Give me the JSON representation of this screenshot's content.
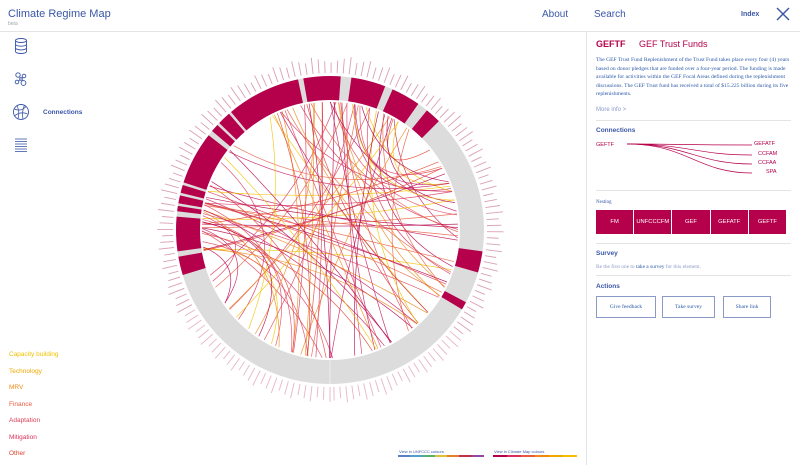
{
  "header": {
    "title": "Climate Regime Map",
    "subtitle": "beta",
    "nav_about": "About",
    "nav_search": "Search",
    "nav_index": "Index"
  },
  "sidebar": {
    "items": [
      {
        "name": "database-icon",
        "label": ""
      },
      {
        "name": "network-icon",
        "label": ""
      },
      {
        "name": "connections-icon",
        "label": "Connections"
      },
      {
        "name": "list-icon",
        "label": ""
      }
    ]
  },
  "legend": {
    "items": [
      {
        "label": "Capacity building",
        "color": "#f2c200"
      },
      {
        "label": "Technology",
        "color": "#f0a800"
      },
      {
        "label": "MRV",
        "color": "#ef8a17"
      },
      {
        "label": "Finance",
        "color": "#e85a3f"
      },
      {
        "label": "Adaptation",
        "color": "#e0405a"
      },
      {
        "label": "Mitigation",
        "color": "#d8315b"
      },
      {
        "label": "Other",
        "color": "#e2402b"
      }
    ]
  },
  "footer": {
    "unfccc_link": "View in UNFCCC colours",
    "crm_link": "View in Climate Map colours",
    "unfccc_colors": [
      "#5b7ec4",
      "#4ea2c9",
      "#58b06a",
      "#e0c03a",
      "#e2802a",
      "#c4304a",
      "#8e4aa8"
    ],
    "crm_colors": [
      "#b5004b",
      "#d8315b",
      "#e85a3f",
      "#ef8a17",
      "#f0a800",
      "#f2c200"
    ]
  },
  "panel": {
    "code": "GEFTF",
    "name": "GEF Trust Funds",
    "description": "The GEF Trust Fund Replenishment of the Trust Fund takes place every four (4) years based on donor pledges that are funded over a four-year period. The funding is made available for activities within the GEF Focal Areas defined during the replenishment discussions. The GEF Trust fund has received a total of $15.225 billion during its five replenishments.",
    "more_info": "More info >",
    "connections_title": "Connections",
    "connection_source": "GEFTF",
    "connection_targets": [
      "GEFATF",
      "CCFAM",
      "CCFAA",
      "SPA"
    ],
    "nesting_title": "Nesting",
    "nesting": [
      "FM",
      "UNFCCCFM",
      "GEF",
      "GEFATF",
      "GEFTF"
    ],
    "survey_title": "Survey",
    "survey_prefix": "Be the first one to",
    "survey_link": "take a survey",
    "survey_suffix": "for this element.",
    "actions_title": "Actions",
    "actions": [
      "Give feedback",
      "Take survey",
      "Share link"
    ]
  },
  "colors": {
    "accent": "#b5004b",
    "link": "#3a57a8",
    "ring_grey": "#dcdcdc"
  }
}
